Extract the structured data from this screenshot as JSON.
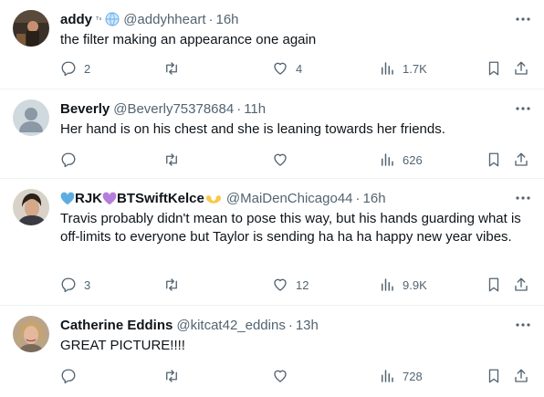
{
  "colors": {
    "text": "#0f1419",
    "muted": "#536471",
    "divider": "#eff3f4"
  },
  "tweets": [
    {
      "name": "addy",
      "name_suffix": "ᵀˢ",
      "handle": "@addyhheart",
      "time": "16h",
      "text": "the filter making an appearance one again",
      "replies": "2",
      "retweets": "",
      "likes": "4",
      "views": "1.7K",
      "avatar": "photo-dark-interior"
    },
    {
      "name": "Beverly",
      "handle": "@Beverly75378684",
      "time": "11h",
      "text": "Her hand is on his chest and she is leaning towards her friends.",
      "replies": "",
      "retweets": "",
      "likes": "",
      "views": "626",
      "avatar": "default-user-silhouette"
    },
    {
      "name_part1": "RJK",
      "name_part2": "BTSwiftKelce",
      "handle": "@MaiDenChicago44",
      "time": "16h",
      "text": "Travis probably didn't mean to pose this way, but his hands guarding what is off-limits to everyone but Taylor is sending ha ha ha happy new year vibes.",
      "replies": "3",
      "retweets": "",
      "likes": "12",
      "views": "9.9K",
      "avatar": "photo-man-dark-hair"
    },
    {
      "name": "Catherine Eddins",
      "handle": "@kitcat42_eddins",
      "time": "13h",
      "text": "GREAT PICTURE!!!!",
      "replies": "",
      "retweets": "",
      "likes": "",
      "views": "728",
      "avatar": "photo-blonde-woman"
    }
  ],
  "separator": "·"
}
